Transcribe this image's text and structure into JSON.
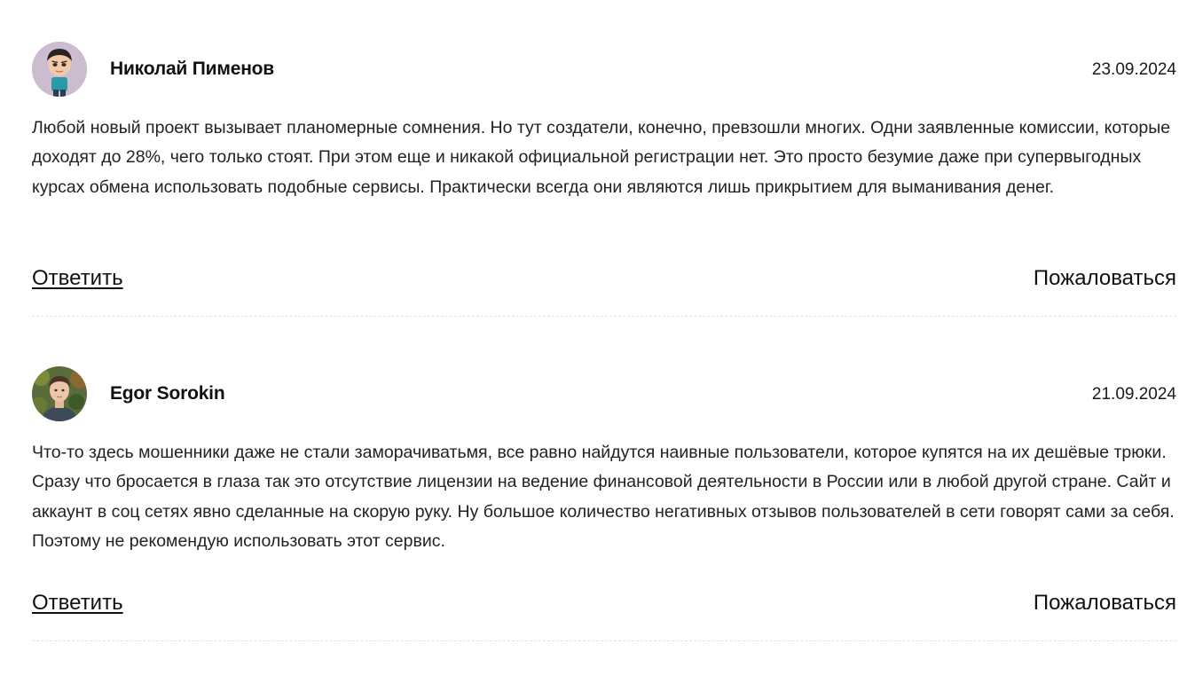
{
  "comments": [
    {
      "author": "Николай Пименов",
      "date": "23.09.2024",
      "avatar_icon": "cartoon-avatar",
      "text": "Любой новый проект вызывает планомерные сомнения. Но тут создатели, конечно, превзошли многих. Одни заявленные комиссии, которые доходят до 28%, чего только стоят. При этом еще и никакой официальной регистрации нет. Это просто безумие даже при супервыгодных курсах обмена использовать подобные сервисы. Практически всегда они являются лишь прикрытием для выманивания денег.",
      "reply_label": "Ответить",
      "report_label": "Пожаловаться"
    },
    {
      "author": "Egor Sorokin",
      "date": "21.09.2024",
      "avatar_icon": "photo-avatar",
      "text": "Что-то здесь мошенники даже не стали заморачиватьмя, все равно найдутся наивные пользователи, которое купятся на их дешёвые трюки. Сразу что бросается в глаза так это отсутствие лицензии на ведение финансовой деятельности в России или в любой другой стране. Сайт и аккаунт в соц сетях явно сделанные на скорую руку. Ну большое количество негативных отзывов пользователей в сети говорят сами за себя. Поэтому не рекомендую использовать этот сервис.",
      "reply_label": "Ответить",
      "report_label": "Пожаловаться"
    }
  ]
}
